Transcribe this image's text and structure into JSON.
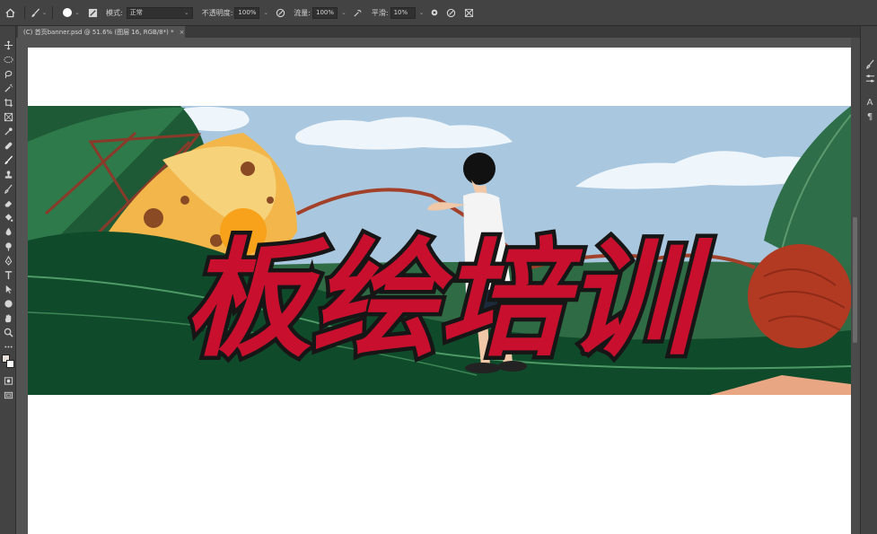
{
  "options_bar": {
    "mode_label": "模式:",
    "mode_value": "正常",
    "opacity_label": "不透明度:",
    "opacity_value": "100%",
    "flow_label": "流量:",
    "flow_value": "100%",
    "smoothing_label": "平滑:",
    "smoothing_value": "10%"
  },
  "document_tab": {
    "title": "(C) 首页banner.psd @ 51.6% (图层 16, RGB/8*) *",
    "close": "×"
  },
  "banner": {
    "headline": "板绘培训"
  },
  "right_panel": {
    "char_icon": "A",
    "para_icon": "¶"
  },
  "colors": {
    "app_bg": "#535353",
    "panel_bg": "#434343",
    "headline_red": "#c8102e",
    "headline_outline": "#161616",
    "sky": "#a9c8e0",
    "leaf_dark": "#1f5a36"
  }
}
